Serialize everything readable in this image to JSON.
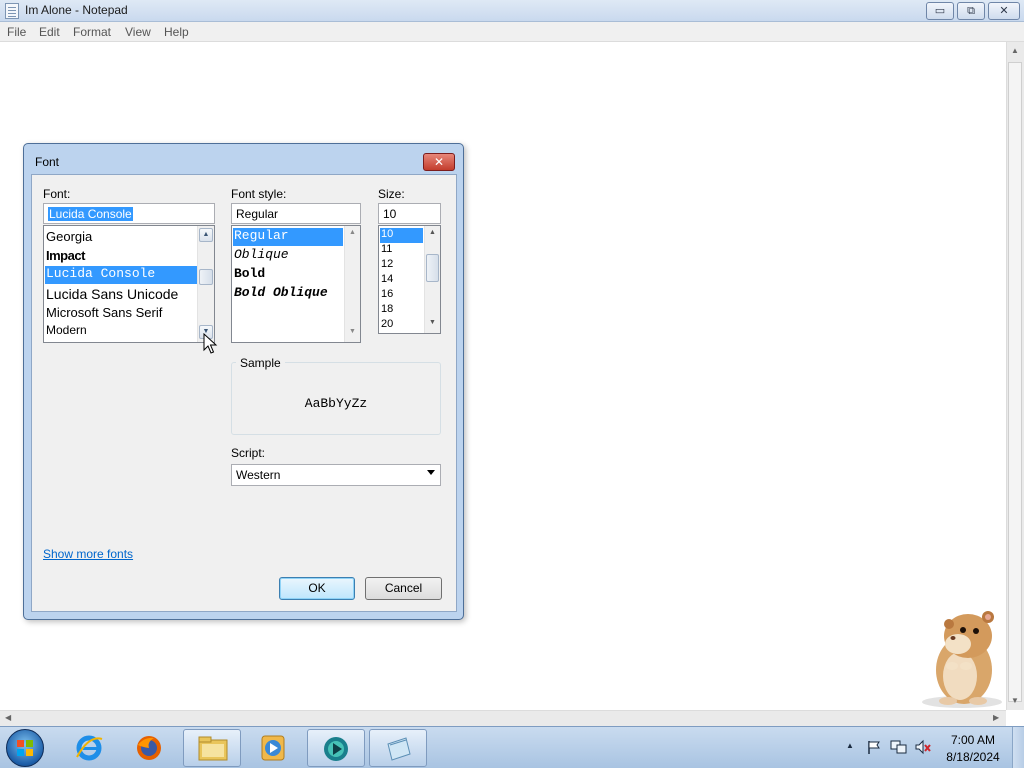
{
  "window": {
    "title": "Im Alone - Notepad",
    "min_glyph": "▭",
    "max_glyph": "⧉",
    "close_glyph": "✕"
  },
  "menu": [
    "File",
    "Edit",
    "Format",
    "View",
    "Help"
  ],
  "dialog": {
    "title": "Font",
    "close_glyph": "✕",
    "font_label": "Font:",
    "font_value": "Lucida Console",
    "font_list": [
      "Georgia",
      "Impact",
      "Lucida Console",
      "Lucida Sans Unicode",
      "Microsoft Sans Serif",
      "Modern"
    ],
    "font_selected": "Lucida Console",
    "style_label": "Font style:",
    "style_value": "Regular",
    "style_list": [
      "Regular",
      "Oblique",
      "Bold",
      "Bold Oblique"
    ],
    "style_selected": "Regular",
    "size_label": "Size:",
    "size_value": "10",
    "size_list": [
      "10",
      "11",
      "12",
      "14",
      "16",
      "18",
      "20"
    ],
    "size_selected": "10",
    "sample_label": "Sample",
    "sample_text": "AaBbYyZz",
    "script_label": "Script:",
    "script_value": "Western",
    "show_more_fonts": "Show more fonts",
    "ok_label": "OK",
    "cancel_label": "Cancel"
  },
  "taskbar": {
    "apps": [
      "internet-explorer-icon",
      "firefox-icon",
      "file-explorer-icon",
      "media-player-icon",
      "app-icon",
      "notepad-icon"
    ],
    "time": "7:00 AM",
    "date": "8/18/2024"
  },
  "colors": {
    "selection": "#3399ff",
    "link": "#0066cc",
    "taskbar": "#b8cfe9"
  }
}
